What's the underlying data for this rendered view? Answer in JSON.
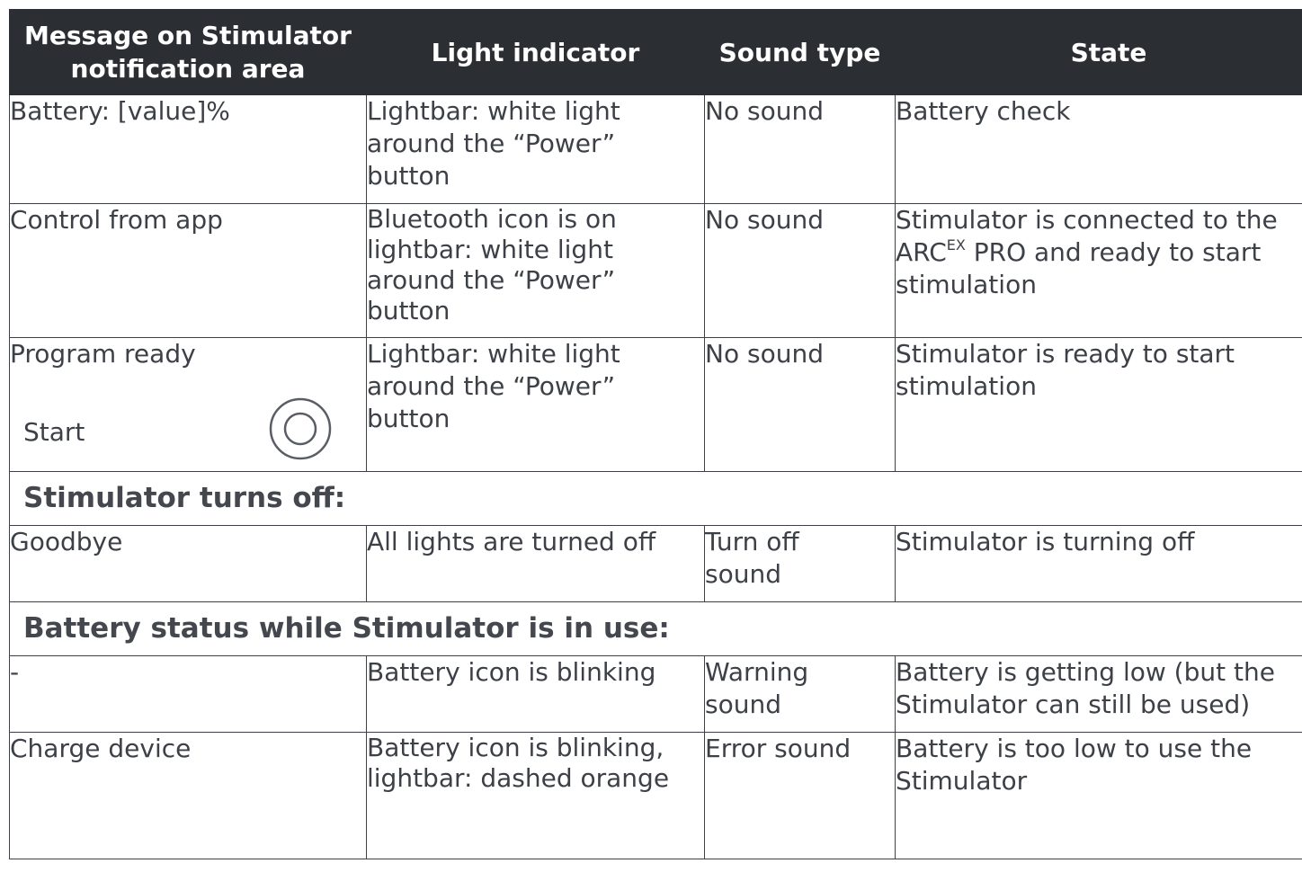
{
  "columns": {
    "message_line1": "Message on Stimulator",
    "message_line2": "notification area",
    "light": "Light indicator",
    "sound": "Sound type",
    "state": "State"
  },
  "rows": [
    {
      "message": "Battery: [value]%",
      "light": "Lightbar: white light around the “Power” button",
      "sound": "No sound",
      "state": "Battery check"
    },
    {
      "message": "Control from app",
      "light": "Bluetooth icon is on lightbar: white light around the “Power” button",
      "sound": "No sound",
      "state_before": "Stimulator is connected to the ARC",
      "state_sup": "EX",
      "state_after": " PRO and ready to start stimulation"
    },
    {
      "message": "Program ready",
      "message2": "Start",
      "icon": "power-button-icon",
      "light": "Lightbar: white light around the “Power” button",
      "sound": "No sound",
      "state": "Stimulator is ready to start stimulation"
    }
  ],
  "section_off": "Stimulator turns off:",
  "rows_off": [
    {
      "message": "Goodbye",
      "light": "All lights are turned off",
      "sound": "Turn off sound",
      "state": "Stimulator is turning off"
    }
  ],
  "section_battery": "Battery status while Stimulator is in use:",
  "rows_battery": [
    {
      "message": "-",
      "light": "Battery icon is blinking",
      "sound": "Warning sound",
      "state": "Battery is getting low (but the Stimulator can still be used)"
    },
    {
      "message": "Charge device",
      "light": "Battery icon is blinking, lightbar: dashed orange",
      "sound": "Error sound",
      "state": "Battery is too low to use the Stimulator"
    }
  ],
  "colors": {
    "header_bg": "#2b2e33",
    "header_text": "#ffffff",
    "body_text": "#3d4147",
    "border": "#3d4147"
  }
}
